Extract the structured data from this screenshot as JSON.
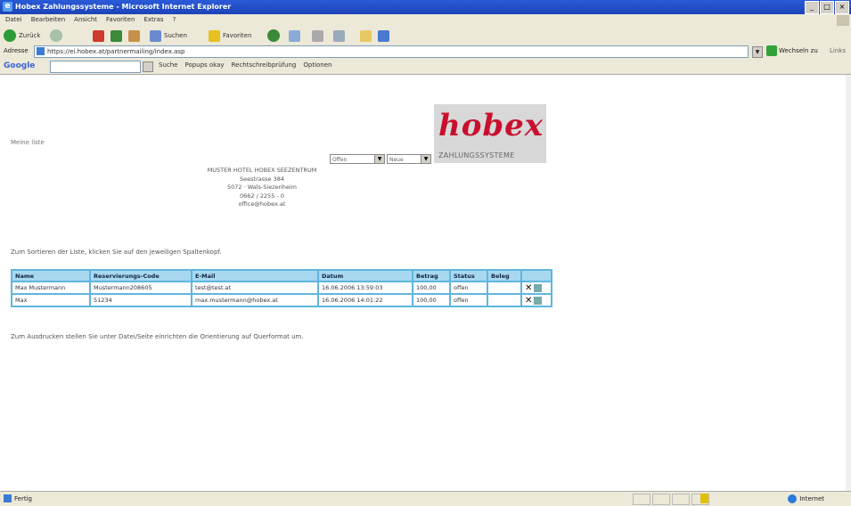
{
  "window": {
    "title": "Hobex Zahlungssysteme - Microsoft Internet Explorer",
    "buttons": [
      "_",
      "□",
      "×"
    ]
  },
  "menu": [
    "Datei",
    "Bearbeiten",
    "Ansicht",
    "Favoriten",
    "Extras",
    "?"
  ],
  "toolbar": {
    "back": "Zurück",
    "search": "Suchen",
    "favorites": "Favoriten"
  },
  "address": {
    "label": "Adresse",
    "url": "https://ei.hobex.at/partnermailing/index.asp",
    "go": "Wechseln zu",
    "links": "Links"
  },
  "google": {
    "logo": "Google",
    "items": [
      "Suche",
      "Popups okay",
      "Rechtschreibprüfung",
      "Optionen"
    ]
  },
  "page": {
    "heading": "Meine liste",
    "logo": {
      "brand": "hobex",
      "sub": "ZAHLUNGSSYSTEME"
    },
    "filter_status": "Offen",
    "filter_sort": "Neue",
    "hotel": [
      "MUSTER HOTEL HOBEX SEEZENTRUM",
      "Seestrasse 384",
      "5072 · Wals-Siezenheim",
      "0662 / 2255 - 0",
      "office@hobex.at"
    ],
    "hint": "Zum Sortieren der Liste, klicken Sie auf den jeweiligen Spaltenkopf.",
    "footer": "Zum Ausdrucken stellen Sie unter Datei/Seite einrichten die Orientierung auf Querformat um."
  },
  "table": {
    "headers": [
      "Name",
      "Reservierungs-Code",
      "E-Mail",
      "Datum",
      "Betrag",
      "Status",
      "Beleg",
      ""
    ],
    "rows": [
      [
        "Max Mustermann",
        "Mustermann208605",
        "test@test.at",
        "16.06.2006 13:59:03",
        "100,00",
        "offen",
        ""
      ],
      [
        "Max",
        "51234",
        "max.mustermann@hobex.at",
        "16.06.2006 14:01:22",
        "100,00",
        "offen",
        ""
      ]
    ]
  },
  "status": {
    "left": "Fertig",
    "zone": "Internet"
  }
}
